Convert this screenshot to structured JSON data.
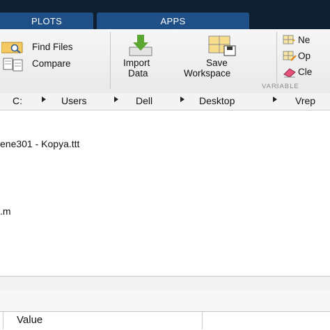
{
  "tabs": {
    "plots": "PLOTS",
    "apps": "APPS"
  },
  "ribbon": {
    "find_files": "Find Files",
    "compare": "Compare",
    "import_line1": "Import",
    "import_line2": "Data",
    "save_line1": "Save",
    "save_line2": "Workspace",
    "new_var": "Ne",
    "open_var": "Op",
    "clear_ws": "Cle",
    "variable_section": "VARIABLE"
  },
  "path": {
    "drive": "C:",
    "segments": [
      "Users",
      "Dell",
      "Desktop",
      "Vrep"
    ]
  },
  "files": [
    "ene301 - Kopya.ttt",
    ".m"
  ],
  "workspace": {
    "value_header": "Value"
  },
  "colors": {
    "tab_bar": "#0f2033",
    "tab": "#1e4f86",
    "ribbon": "#efefef"
  }
}
